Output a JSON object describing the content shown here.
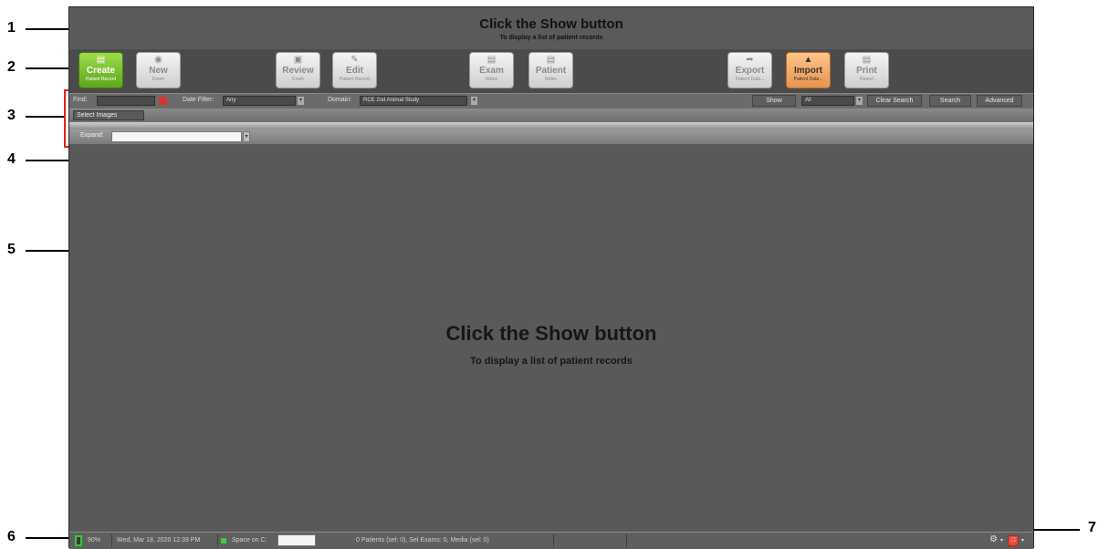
{
  "callouts": [
    {
      "num": "1"
    },
    {
      "num": "2"
    },
    {
      "num": "3"
    },
    {
      "num": "4"
    },
    {
      "num": "5"
    },
    {
      "num": "6"
    },
    {
      "num": "7"
    }
  ],
  "header": {
    "title": "Click the Show button",
    "subtitle": "To display a list of patient records"
  },
  "toolbar": {
    "buttons": [
      {
        "label": "Create",
        "sub": "Patient Record",
        "icon": "id-card-icon"
      },
      {
        "label": "New",
        "sub": "Exam",
        "icon": "camera-icon"
      },
      {
        "label": "Review",
        "sub": "Exam",
        "icon": "monitor-icon"
      },
      {
        "label": "Edit",
        "sub": "Patient Record",
        "icon": "edit-icon"
      },
      {
        "label": "Exam",
        "sub": "Notes",
        "icon": "notes-icon"
      },
      {
        "label": "Patient",
        "sub": "Notes",
        "icon": "notes-icon"
      },
      {
        "label": "Export",
        "sub": "Patient Data...",
        "icon": "export-icon"
      },
      {
        "label": "Import",
        "sub": "Patient Data...",
        "icon": "import-icon"
      },
      {
        "label": "Print",
        "sub": "Report",
        "icon": "printer-icon"
      }
    ]
  },
  "search": {
    "find_label": "Find:",
    "find_value": "",
    "date_filter_label": "Date Filter:",
    "date_filter_value": "Any",
    "domain_label": "Domain:",
    "domain_value": "RCE 2nd Animal Study",
    "show_label": "Show",
    "show_value": "All",
    "clear_search": "Clear Search",
    "search": "Search",
    "advanced": "Advanced"
  },
  "select_images": "Select Images",
  "expand": {
    "label": "Expand:",
    "value": ""
  },
  "content": {
    "title": "Click the Show button",
    "subtitle": "To display a list of patient records"
  },
  "status": {
    "battery": "90%",
    "datetime": "Wed, Mar 18, 2020 12:39 PM",
    "space_label": "Space on C:",
    "counts": "0 Patients (sel: 0), Sel Exams: 0, Media (sel: 0)"
  },
  "colors": {
    "app_background": "#595959",
    "create_button": "#7cc334",
    "import_button": "#f0a866",
    "annotation_line": "#000000",
    "annotation_bracket": "#e2231a"
  }
}
